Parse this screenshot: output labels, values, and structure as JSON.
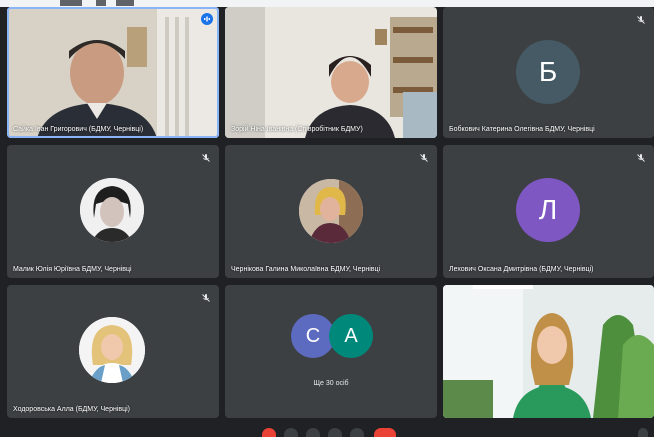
{
  "colors": {
    "background": "#202124",
    "tile": "#3c4043",
    "speaking_outline": "#8ab4f8",
    "avatar_b": "#455a64",
    "avatar_l": "#7e57c2",
    "avatar_s": "#5c6bc0",
    "avatar_a": "#00897b",
    "end_call": "#ea4335"
  },
  "tiles": [
    {
      "name": "Сайка Іван Григорович (БДМУ, Чернівці)",
      "type": "video-man",
      "speaking": true
    },
    {
      "name": "Зорій Ніна Іванівна (Співробітник БДМУ)",
      "type": "video-woman"
    },
    {
      "name": "Бобкович Катерина Олегівна БДМУ, Чернівці",
      "type": "letter",
      "letter": "Б"
    },
    {
      "name": "Малик Юлія Юріївна БДМУ, Чернівці",
      "type": "photo"
    },
    {
      "name": "Чернікова Галина Миколаївна БДМУ, Чернівці",
      "type": "photo"
    },
    {
      "name": "Лехович Оксана Дмитрівна (БДМУ, Чернівці)",
      "type": "letter",
      "letter": "Л"
    },
    {
      "name": "Ходоровська Алла (БДМУ, Чернівці)",
      "type": "photo"
    },
    {
      "type": "others",
      "letters": [
        "С",
        "А"
      ],
      "count_label": "Ще 30 осіб"
    },
    {
      "type": "video-presenter"
    }
  ],
  "icons": {
    "mic_off": "mic-off-icon",
    "audio_active": "audio-active-icon"
  }
}
